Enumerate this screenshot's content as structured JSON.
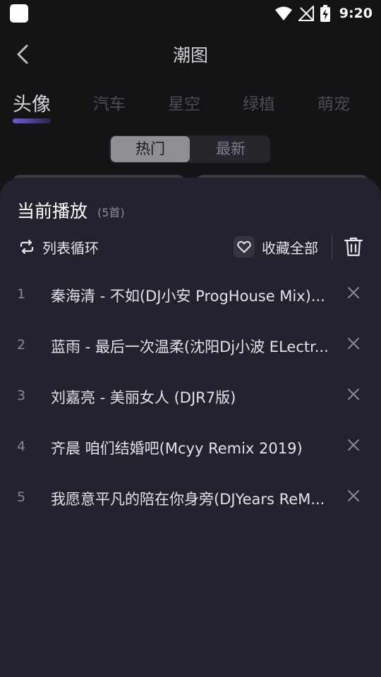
{
  "status_bar": {
    "time": "9:20"
  },
  "header": {
    "title": "潮图"
  },
  "tabs": [
    {
      "label": "头像",
      "active": true
    },
    {
      "label": "汽车",
      "active": false
    },
    {
      "label": "星空",
      "active": false
    },
    {
      "label": "绿植",
      "active": false
    },
    {
      "label": "萌宠",
      "active": false
    }
  ],
  "segment": {
    "hot": "热门",
    "latest": "最新",
    "selected": "热门"
  },
  "sheet": {
    "title": "当前播放",
    "count": "(5首)",
    "loop_label": "列表循环",
    "favorite_all_label": "收藏全部",
    "songs": [
      {
        "index": "1",
        "name": "秦海清 - 不如(DJ小安 ProgHouse Mix)..."
      },
      {
        "index": "2",
        "name": "蓝雨 - 最后一次温柔(沈阳Dj小波 ELectr..."
      },
      {
        "index": "3",
        "name": "刘嘉亮 - 美丽女人 (DJR7版)"
      },
      {
        "index": "4",
        "name": "齐晨 咱们结婚吧(Mcyy Remix 2019)"
      },
      {
        "index": "5",
        "name": "我愿意平凡的陪在你身旁(DJYears ReM..."
      }
    ]
  },
  "colors": {
    "background": "#141417",
    "sheet": "#23232f",
    "accent": "#6b5cd8"
  }
}
